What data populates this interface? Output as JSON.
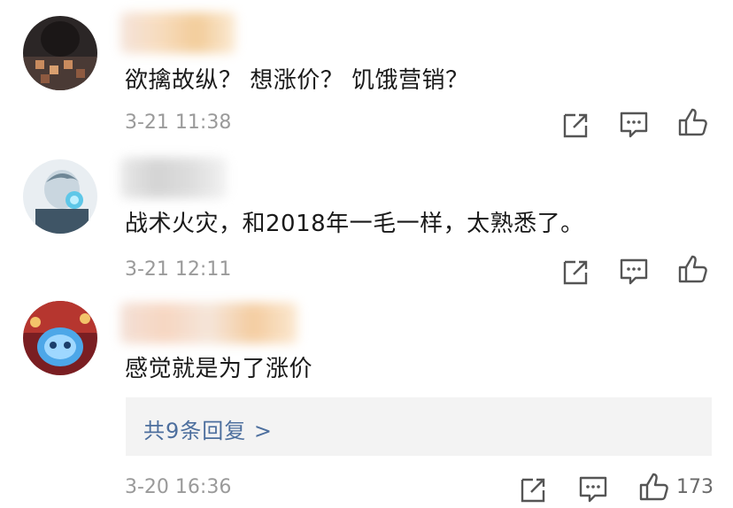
{
  "comments": [
    {
      "text": "欲擒故纵？ 想涨价？ 饥饿营销？",
      "time": "3-21 11:38",
      "like_count": ""
    },
    {
      "text": "战术火灾，和2018年一毛一样，太熟悉了。",
      "time": "3-21 12:11",
      "like_count": ""
    },
    {
      "text": "感觉就是为了涨价",
      "time": "3-20 16:36",
      "replies_label": "共9条回复 >",
      "like_count": "173"
    }
  ],
  "icons": {
    "share": "share-icon",
    "comment": "comment-icon",
    "like": "thumbs-up-icon"
  },
  "colors": {
    "text": "#1a1a1a",
    "meta": "#9a9a9a",
    "reply_link": "#4d6f9e",
    "reply_bg": "#f3f3f3"
  }
}
